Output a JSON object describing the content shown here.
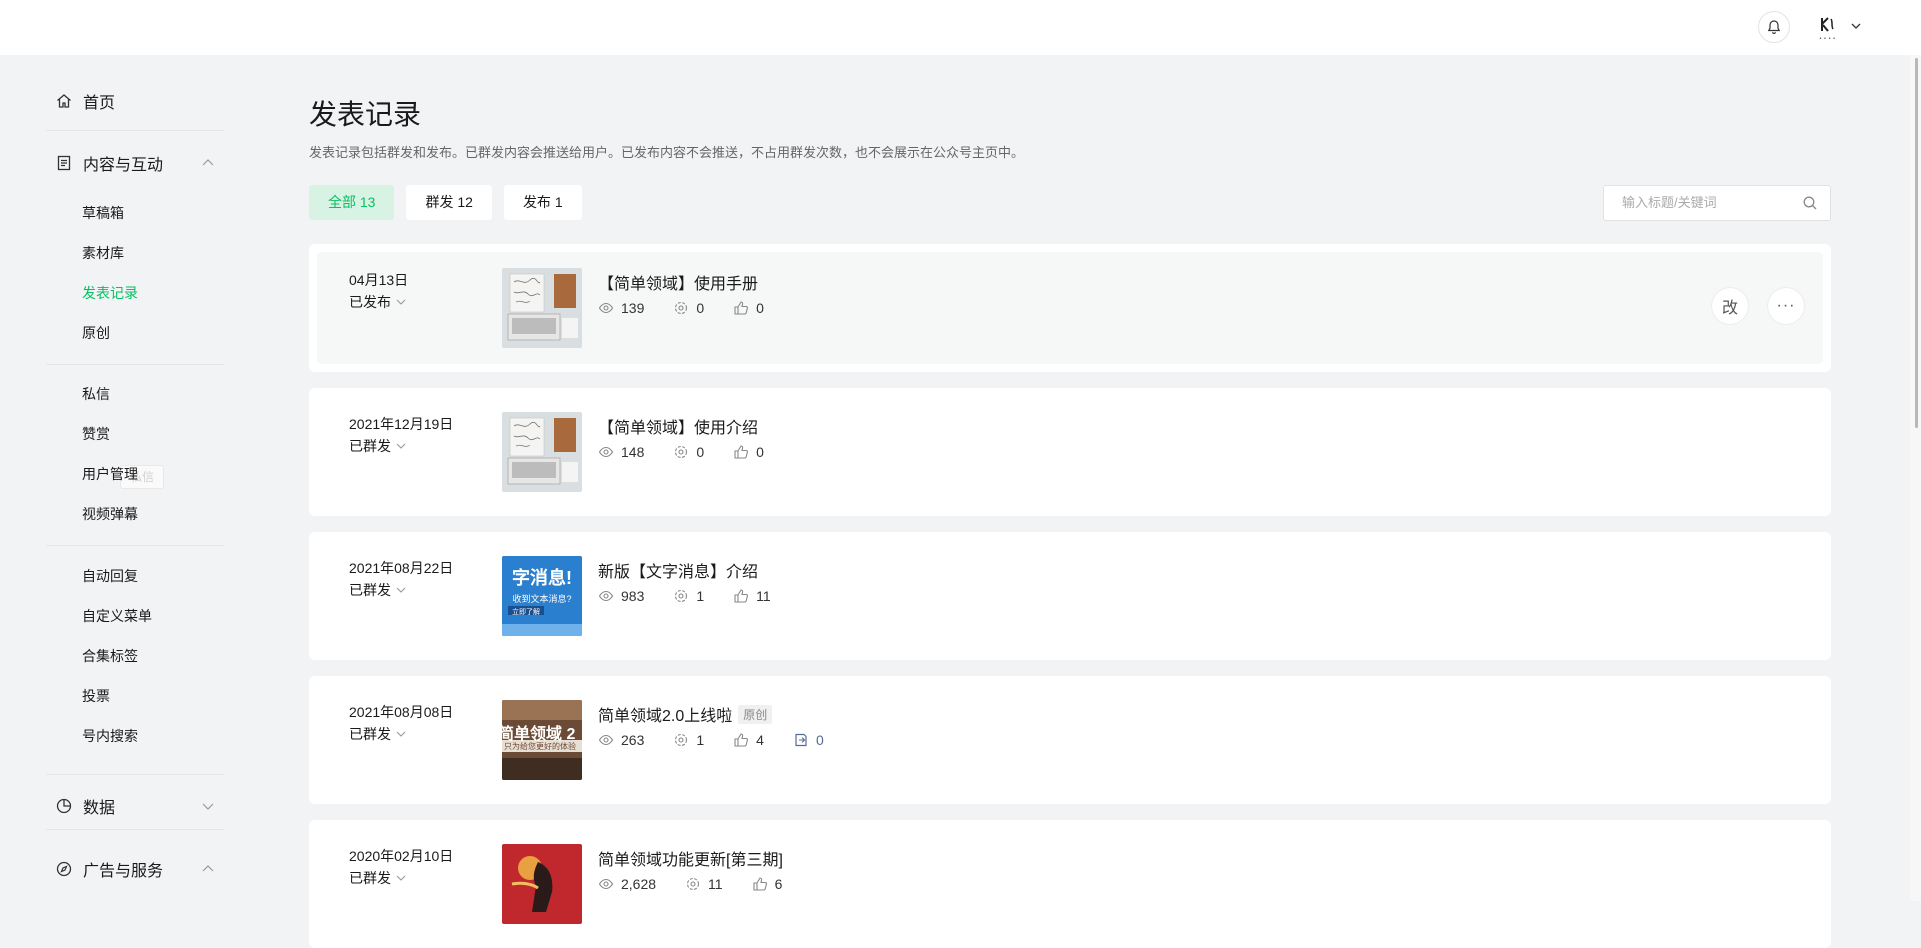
{
  "header": {
    "bell_icon": "bell-icon",
    "avatar_icon": "avatar-icon"
  },
  "sidebar": {
    "home": "首页",
    "content_section": "内容与互动",
    "content_items": [
      "草稿箱",
      "素材库",
      "发表记录",
      "原创"
    ],
    "interaction_items": [
      "私信",
      "赞赏",
      "用户管理",
      "视频弹幕"
    ],
    "tool_items": [
      "自动回复",
      "自定义菜单",
      "合集标签",
      "投票",
      "号内搜索"
    ],
    "data_section": "数据",
    "ads_section": "广告与服务",
    "ghost_tooltip": "私信",
    "active_color": "#07c160"
  },
  "main": {
    "title": "发表记录",
    "description": "发表记录包括群发和发布。已群发内容会推送给用户。已发布内容不会推送，不占用群发次数，也不会展示在公众号主页中。",
    "tabs": [
      {
        "label": "全部 13",
        "active": true
      },
      {
        "label": "群发 12",
        "active": false
      },
      {
        "label": "发布 1",
        "active": false
      }
    ],
    "search": {
      "placeholder": "输入标题/关键词",
      "value": ""
    },
    "actions": {
      "edit": "改",
      "more": "···"
    },
    "records": [
      {
        "date": "04月13日",
        "status": "已发布",
        "title": "【简单领域】使用手册",
        "reads": "139",
        "shares": "0",
        "likes": "0",
        "thumb": "laptop"
      },
      {
        "date": "2021年12月19日",
        "status": "已群发",
        "title": "【简单领域】使用介绍",
        "reads": "148",
        "shares": "0",
        "likes": "0",
        "thumb": "laptop"
      },
      {
        "date": "2021年08月22日",
        "status": "已群发",
        "title": "新版【文字消息】介绍",
        "reads": "983",
        "shares": "1",
        "likes": "11",
        "thumb": "blue",
        "thumb_text": [
          "字消息!",
          "收到文本消息?",
          "立即了解"
        ]
      },
      {
        "date": "2021年08月08日",
        "status": "已群发",
        "title": "简单领域2.0上线啦",
        "badge": "原创",
        "reads": "263",
        "shares": "1",
        "likes": "4",
        "comments": "0",
        "thumb": "brown",
        "thumb_text": [
          "简单领域 2",
          "只为给您更好的体验"
        ]
      },
      {
        "date": "2020年02月10日",
        "status": "已群发",
        "title": "简单领域功能更新[第三期]",
        "reads": "2,628",
        "shares": "11",
        "likes": "6",
        "thumb": "red"
      }
    ]
  }
}
